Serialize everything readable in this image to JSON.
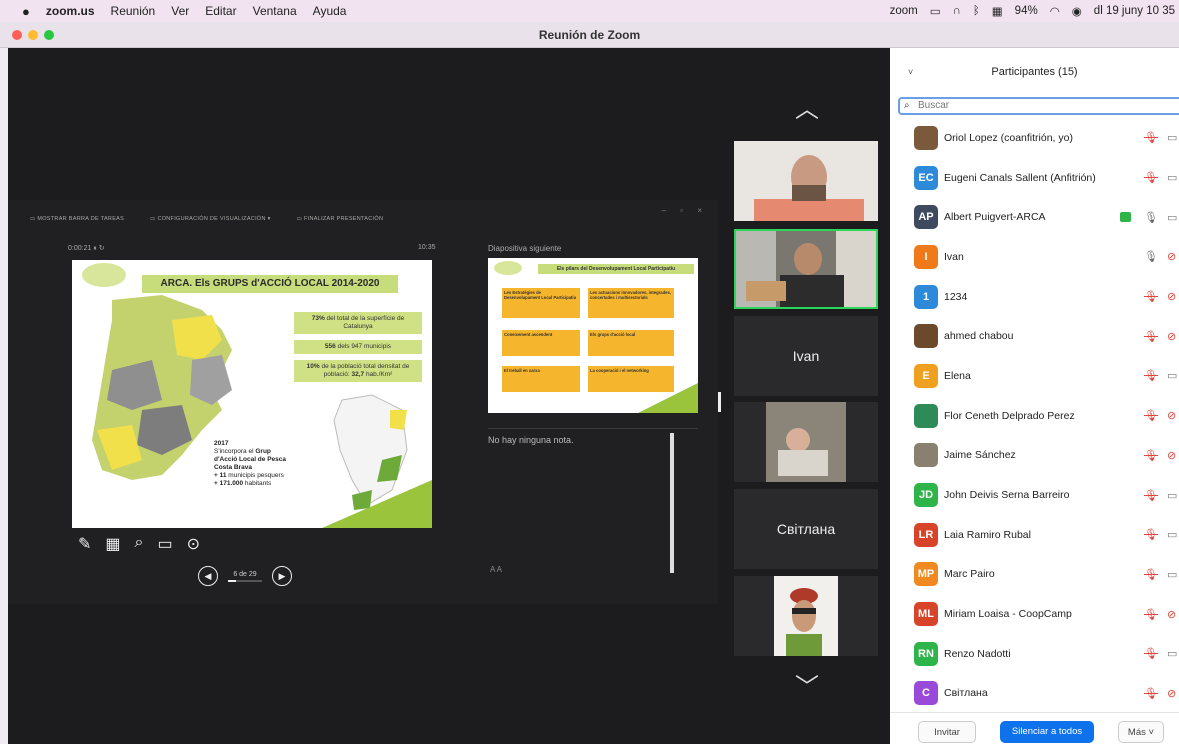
{
  "menubar": {
    "apple": "",
    "app": "zoom.us",
    "items": [
      "Reunión",
      "Ver",
      "Editar",
      "Ventana",
      "Ayuda"
    ],
    "status": [
      "zoom",
      "94%",
      "dl 19 juny 10 35"
    ]
  },
  "window": {
    "title": "Reunión de Zoom"
  },
  "presenter": {
    "toolbar": [
      "MOSTRAR BARRA DE TAREAS",
      "CONFIGURACIÓN DE VISUALIZACIÓN ▾",
      "FINALIZAR PRESENTACIÓN"
    ],
    "window_controls": "– ▫ ×",
    "timer": "0:00:21  ⏸  ↻",
    "clock": "10:35",
    "next_label": "Diapositiva siguiente",
    "notes_text": "No hay ninguna nota.",
    "notes_font_label": "A  A",
    "page_label": "6 de 29",
    "slide": {
      "title": "ARCA. Els GRUPS d'ACCIÓ LOCAL 2014-2020",
      "stat1_bold": "73%",
      "stat1_rest": " del total de la superfície de Catalunya",
      "stat2_bold": "556",
      "stat2_rest": " dels 947 municipis",
      "stat3_bold": "10%",
      "stat3_rest": " de la població total densitat de població: ",
      "stat3_bold2": "32,7",
      "stat3_tail": " hab./Km²",
      "note_year": "2017",
      "note_line1": "S'incorpora el ",
      "note_bold1": "Grup",
      "note_bold2": "d'Acció Local de Pesca",
      "note_bold3": "Costa Brava",
      "note_b1": "+ 11",
      "note_b1_rest": " municipis pesquers",
      "note_b2": "+ 171.000",
      "note_b2_rest": " habitants"
    },
    "next_slide": {
      "title": "Els pilars del Desenvolupament Local Participatiu",
      "boxes": [
        "Les Estratègies de Desenvolupament Local Participatiu",
        "Les actuacions innovadores, integrades, concertades i multisectorials",
        "Coneixement ascendent",
        "Els grups d'acció local",
        "El treball en xarxa",
        "La cooperació i el networking"
      ]
    }
  },
  "video": {
    "tiles": [
      "Ivan",
      "Світлана"
    ]
  },
  "participants": {
    "title": "Participantes (15)",
    "search_placeholder": "Buscar",
    "list": [
      {
        "initials": "",
        "name": "Oriol Lopez (coanfitrión, yo)",
        "color": "#7a5a3a",
        "mic": "muted",
        "video": "off"
      },
      {
        "initials": "EC",
        "name": "Eugeni Canals Sallent (Anfitrión)",
        "color": "#2d8ad8",
        "mic": "muted",
        "video": "off"
      },
      {
        "initials": "AP",
        "name": "Albert Puigvert-ARCA",
        "color": "#3f4a5f",
        "mic": "on",
        "video": "off"
      },
      {
        "initials": "I",
        "name": "Ivan",
        "color": "#f07a1a",
        "mic": "on",
        "video": "off-red"
      },
      {
        "initials": "1",
        "name": "1234",
        "color": "#2d8ad8",
        "mic": "muted",
        "video": "off-red"
      },
      {
        "initials": "",
        "name": "ahmed chabou",
        "color": "#6a4a2a",
        "mic": "muted",
        "video": "off-red"
      },
      {
        "initials": "E",
        "name": "Elena",
        "color": "#f0a020",
        "mic": "muted",
        "video": "off"
      },
      {
        "initials": "",
        "name": "Flor Ceneth Delprado Perez",
        "color": "#2e8b57",
        "mic": "muted",
        "video": "off-red"
      },
      {
        "initials": "",
        "name": "Jaime Sánchez",
        "color": "#8a8070",
        "mic": "muted",
        "video": "off-red"
      },
      {
        "initials": "JD",
        "name": "John Deivis Serna Barreiro",
        "color": "#2fb44a",
        "mic": "muted",
        "video": "off"
      },
      {
        "initials": "LR",
        "name": "Laia Ramiro Rubal",
        "color": "#d8442a",
        "mic": "muted",
        "video": "off"
      },
      {
        "initials": "MP",
        "name": "Marc Pairo",
        "color": "#f08a20",
        "mic": "muted",
        "video": "off"
      },
      {
        "initials": "ML",
        "name": "Miriam Loaisa - CoopCamp",
        "color": "#d8442a",
        "mic": "muted",
        "video": "off-red"
      },
      {
        "initials": "RN",
        "name": "Renzo Nadotti",
        "color": "#2fb44a",
        "mic": "muted",
        "video": "off"
      },
      {
        "initials": "C",
        "name": "Світлана",
        "color": "#9a4ad8",
        "mic": "muted",
        "video": "off-red"
      }
    ],
    "invite": "Invitar",
    "mute_all": "Silenciar a todos",
    "more": "Más ˅"
  }
}
